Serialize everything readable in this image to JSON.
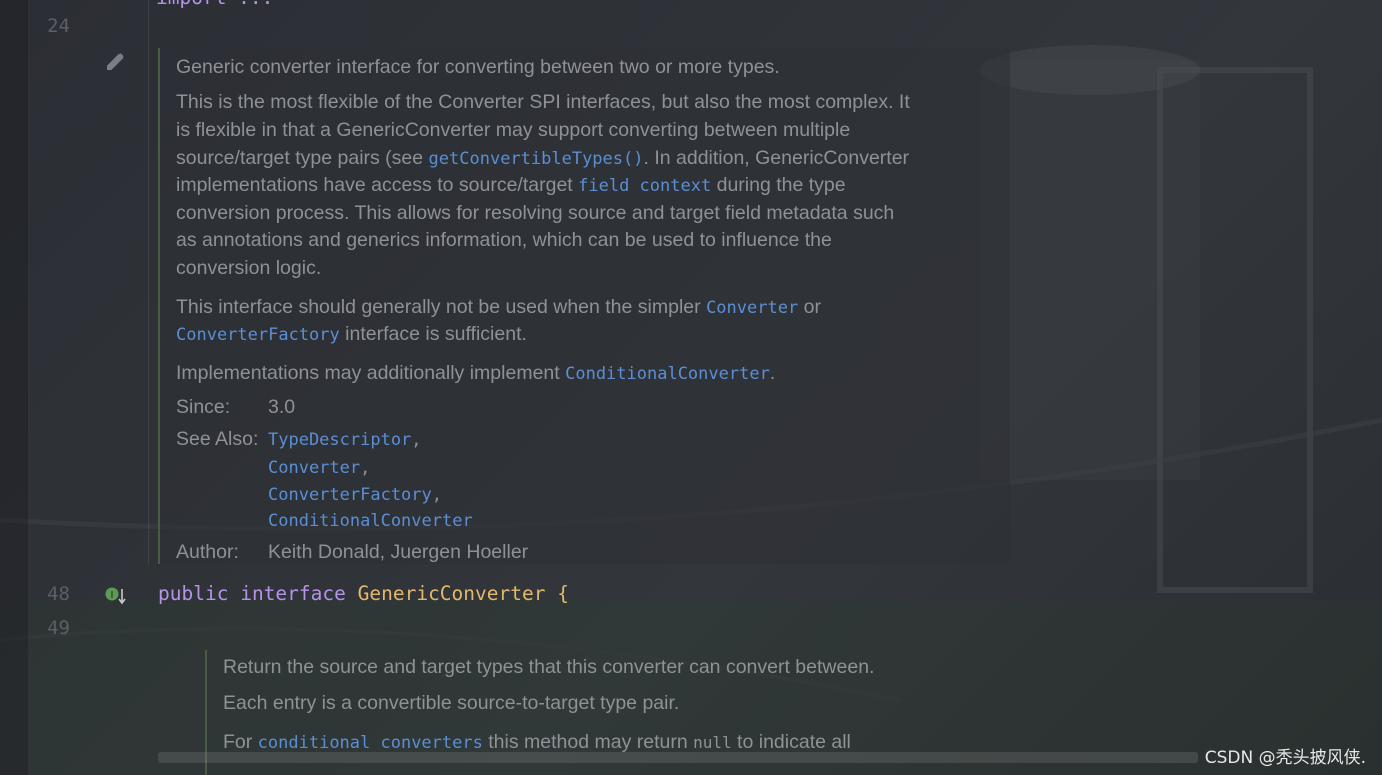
{
  "editor": {
    "line_numbers": {
      "l24": "24",
      "l48": "48",
      "l49": "49"
    },
    "top_partial": "import ...",
    "doc_comment": {
      "summary": "Generic converter interface for converting between two or more types.",
      "para1": [
        {
          "t": "This is the most flexible of the Converter SPI interfaces, but also the most complex. It"
        },
        {
          "t": "is flexible in that a GenericConverter may support converting between multiple"
        },
        {
          "t": "source/target type pairs (see ",
          "code": "getConvertibleTypes()",
          "after": ". In addition, GenericConverter"
        },
        {
          "t": "implementations have access to source/target ",
          "code": "field context",
          "after": " during the type"
        },
        {
          "t": "conversion process. This allows for resolving source and target field metadata such"
        },
        {
          "t": "as annotations and generics information, which can be used to influence the"
        },
        {
          "t": "conversion logic."
        }
      ],
      "para2_a": "This interface should generally not be used when the simpler ",
      "para2_code1": "Converter",
      "para2_b": " or",
      "para2_code2": "ConverterFactory",
      "para2_c": " interface is sufficient.",
      "para3_a": "Implementations may additionally implement ",
      "para3_code": "ConditionalConverter",
      "para3_b": ".",
      "since_label": "Since:",
      "since_value": "3.0",
      "see_also_label": "See Also:",
      "see_also": [
        "TypeDescriptor",
        "Converter",
        "ConverterFactory",
        "ConditionalConverter"
      ],
      "author_label": "Author:",
      "author_value": "Keith Donald, Juergen Hoeller"
    },
    "code_line": {
      "kw1": "public",
      "kw2": "interface",
      "name": "GenericConverter",
      "brace": "{"
    },
    "doc_comment2": {
      "line1": "Return the source and target types that this converter can convert between.",
      "line2": "Each entry is a convertible source-to-target type pair.",
      "line3_a": "For ",
      "line3_code": "conditional converters",
      "line3_b": " this method may return ",
      "line3_null": "null",
      "line3_c": " to indicate all"
    }
  },
  "watermark": "CSDN @秃头披风侠."
}
